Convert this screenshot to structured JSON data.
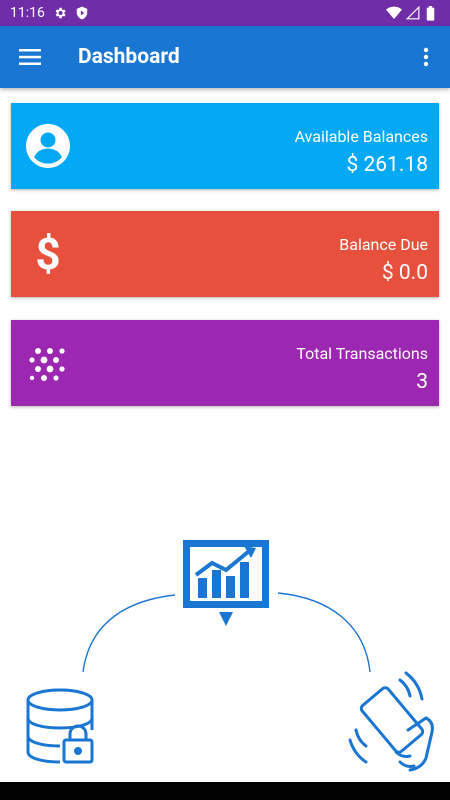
{
  "status_bar": {
    "time": "11:16",
    "icons": [
      "gear-icon",
      "shield-icon",
      "wifi-icon",
      "cellular-icon",
      "battery-icon"
    ]
  },
  "app_bar": {
    "title": "Dashboard",
    "menu_icon": "hamburger-menu-icon",
    "overflow_icon": "more-vert-icon",
    "color": "#1976d2"
  },
  "cards": [
    {
      "label": "Available Balances",
      "value": "$ 261.18",
      "icon": "account-circle-icon",
      "color": "#03a9f4"
    },
    {
      "label": "Balance Due",
      "value": "$ 0.0",
      "icon": "dollar-icon",
      "color": "#e8503e"
    },
    {
      "label": "Total Transactions",
      "value": "3",
      "icon": "dots-pattern-icon",
      "color": "#9c27b0"
    }
  ],
  "illustration": {
    "items": [
      "analytics-chart-icon",
      "database-lock-icon",
      "mobile-tap-icon"
    ],
    "color": "#1976d2"
  }
}
